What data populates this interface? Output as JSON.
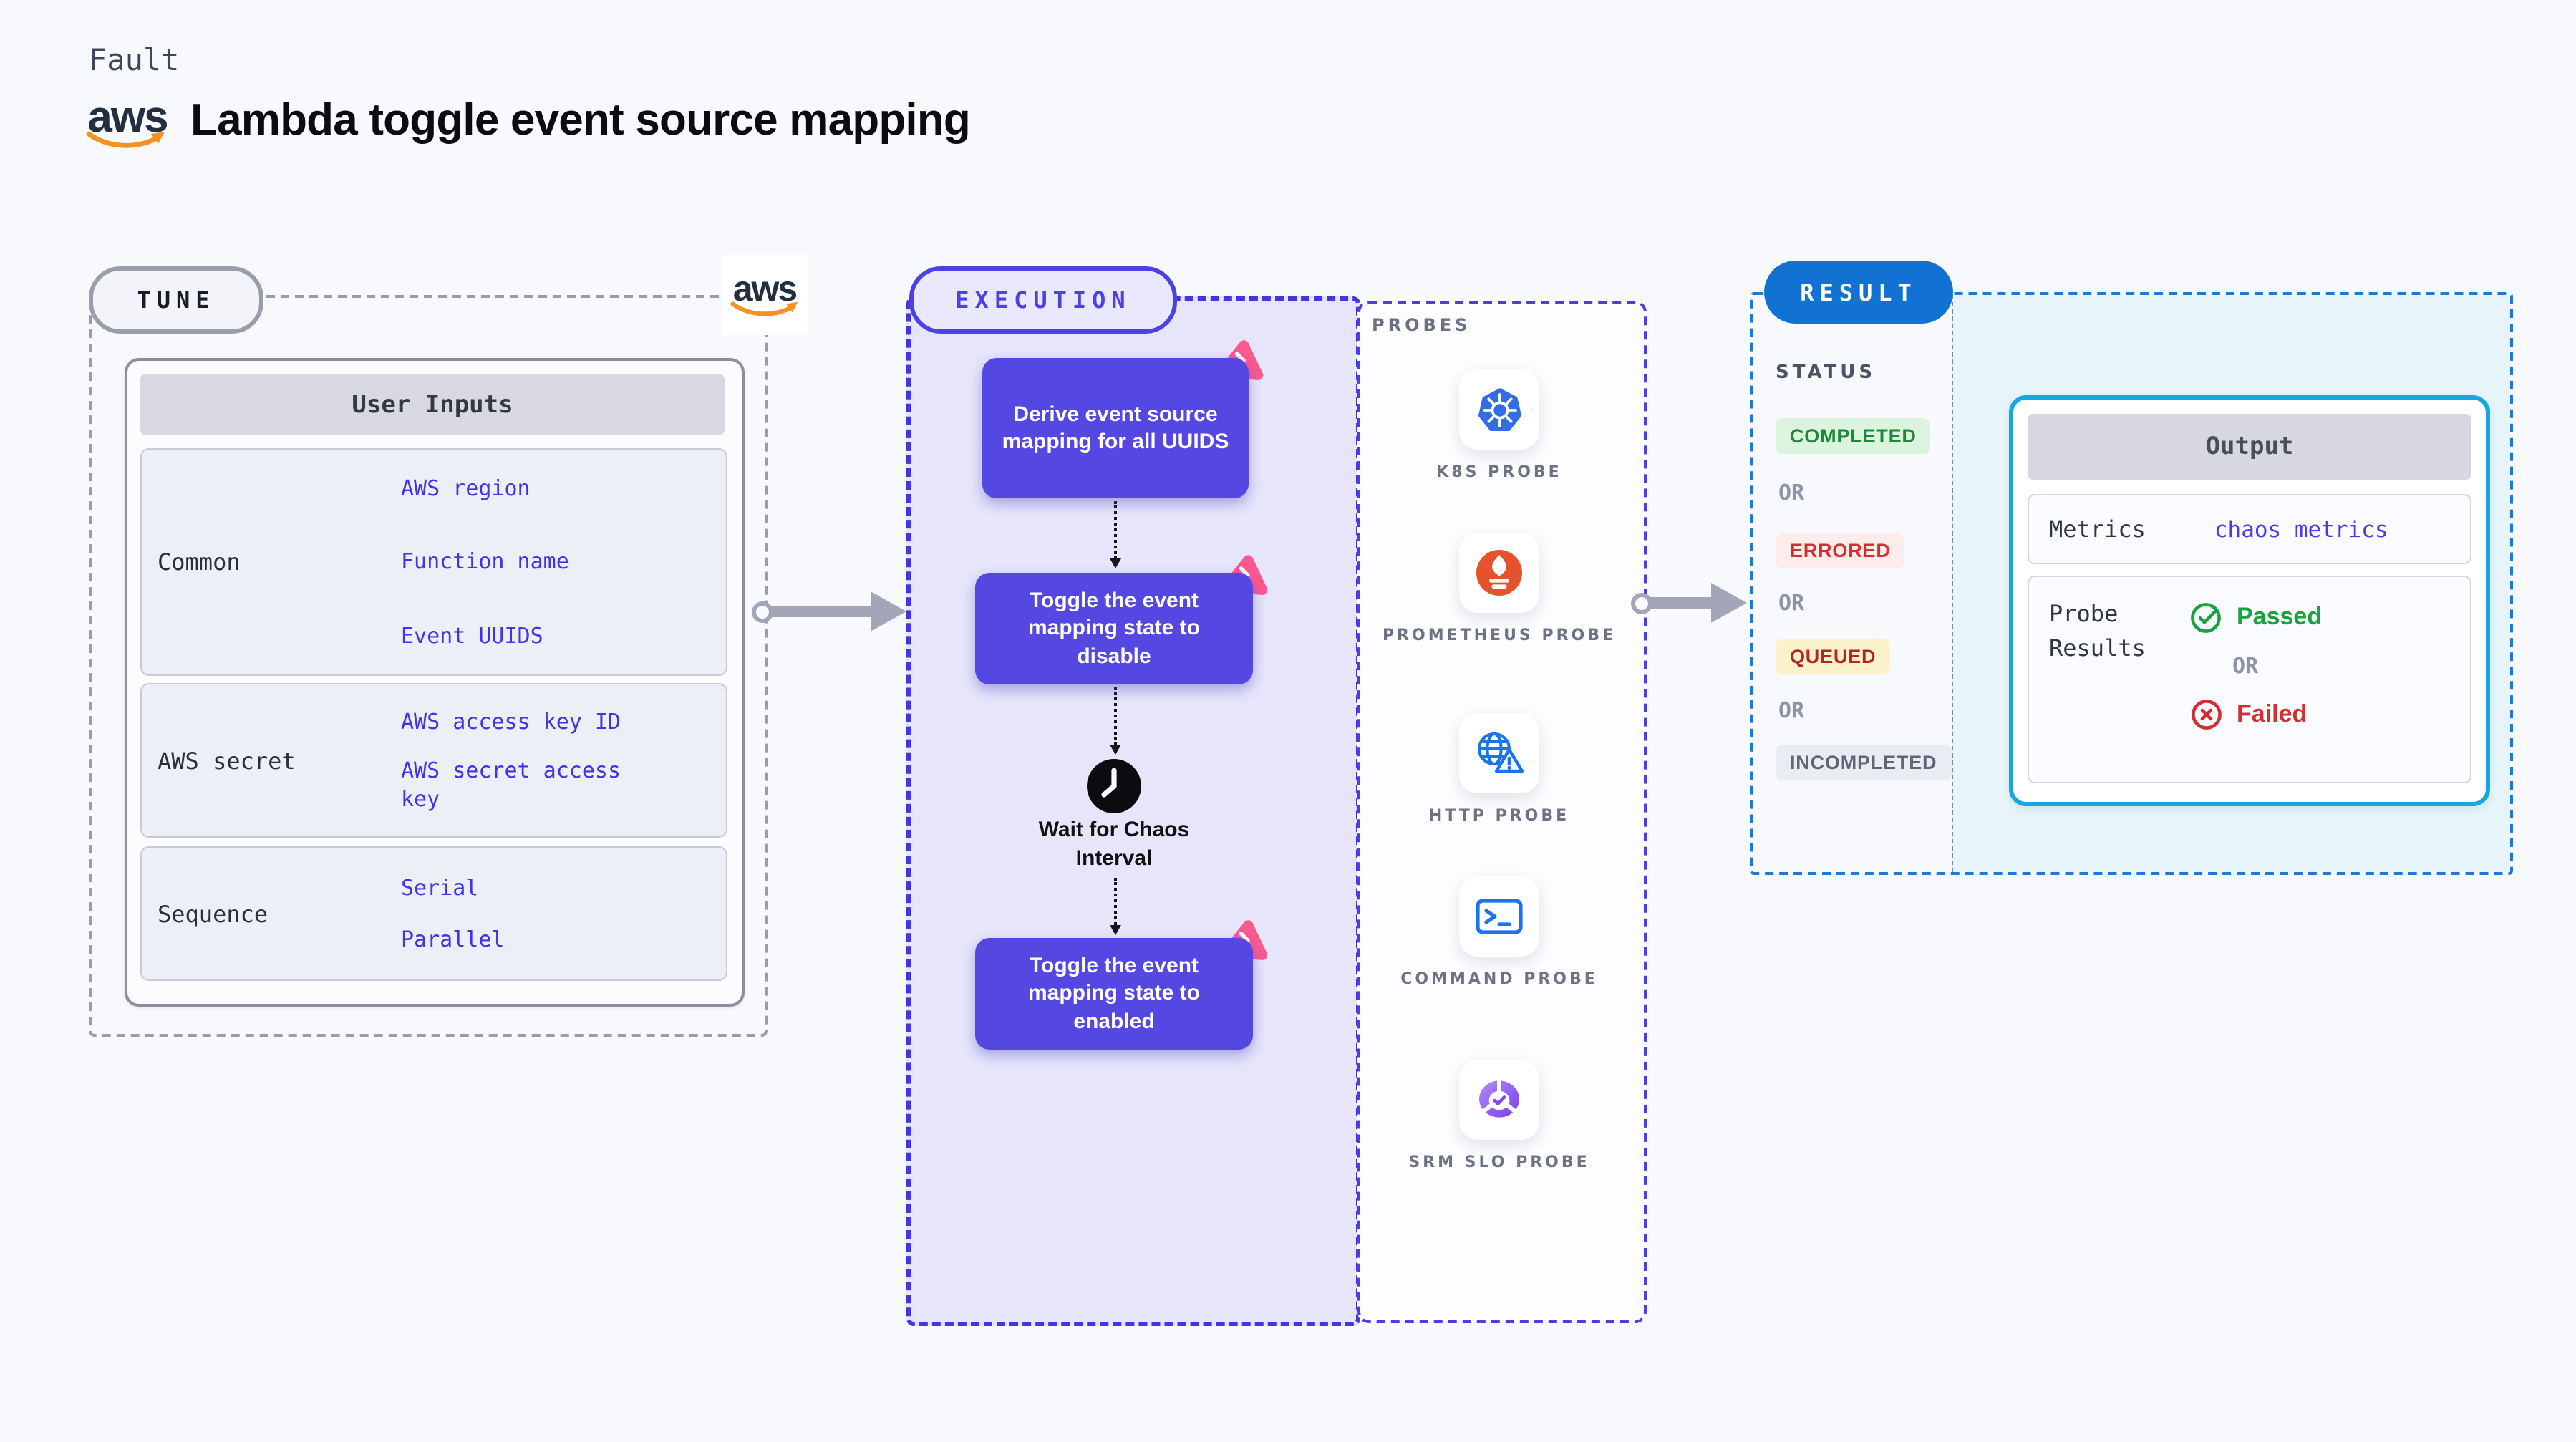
{
  "header": {
    "eyebrow": "Fault",
    "title": "Lambda toggle event source mapping",
    "aws_wordmark": "aws"
  },
  "tune": {
    "badge": "TUNE",
    "aws_wordmark": "aws",
    "table": {
      "header": "User Inputs",
      "rows": [
        {
          "label": "Common",
          "links": [
            "AWS region",
            "Function name",
            "Event UUIDS"
          ]
        },
        {
          "label": "AWS secret",
          "links": [
            "AWS access key ID",
            "AWS secret access key"
          ]
        },
        {
          "label": "Sequence",
          "links": [
            "Serial",
            "Parallel"
          ]
        }
      ]
    }
  },
  "execution": {
    "badge": "EXECUTION",
    "nodes": [
      "Derive event source mapping for all UUIDS",
      "Toggle the event mapping state to disable",
      "Toggle the event mapping state to enabled"
    ],
    "wait_label": "Wait for Chaos Interval"
  },
  "probes": {
    "label": "PROBES",
    "items": [
      {
        "name": "K8S PROBE",
        "icon": "kubernetes-icon"
      },
      {
        "name": "PROMETHEUS PROBE",
        "icon": "prometheus-icon"
      },
      {
        "name": "HTTP PROBE",
        "icon": "globe-warning-icon"
      },
      {
        "name": "COMMAND PROBE",
        "icon": "terminal-icon"
      },
      {
        "name": "SRM SLO PROBE",
        "icon": "slo-donut-icon"
      }
    ]
  },
  "result": {
    "badge": "RESULT",
    "status_label": "STATUS",
    "or": "OR",
    "statuses": [
      {
        "text": "COMPLETED",
        "bg": "#dcf4dd",
        "color": "#1a8a38"
      },
      {
        "text": "ERRORED",
        "bg": "#fdeceb",
        "color": "#d23030"
      },
      {
        "text": "QUEUED",
        "bg": "#fbf2cc",
        "color": "#b3271f"
      },
      {
        "text": "INCOMPLETED",
        "bg": "#eaecf3",
        "color": "#606578"
      }
    ],
    "output": {
      "header": "Output",
      "metrics_label": "Metrics",
      "metrics_link": "chaos metrics",
      "probe_results_label": "Probe Results",
      "passed": "Passed",
      "or": "OR",
      "failed": "Failed"
    }
  },
  "colors": {
    "page_bg": "#f8f9fd",
    "node_indigo": "#5447e2",
    "execution_border": "#4136e0",
    "result_blue": "#1172d3",
    "output_border": "#16a7e0",
    "link_blue": "#3d35e6",
    "chaos_pink": "#fa5a8e",
    "passed_green": "#19a23d",
    "failed_red": "#d23030",
    "aws_orange": "#f6921e",
    "arrow_gray": "#a4a5b8"
  }
}
